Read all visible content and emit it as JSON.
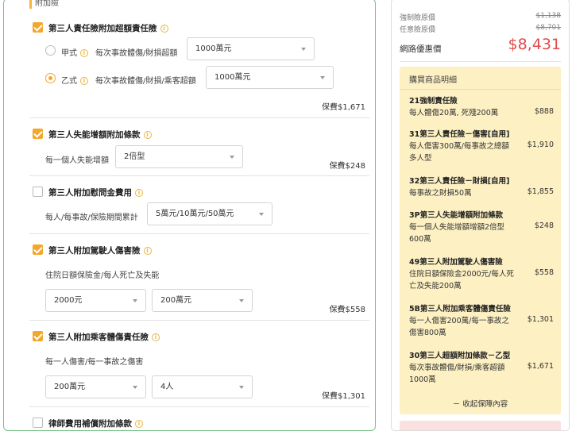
{
  "form": {
    "section_tab": "附加險",
    "sections": [
      {
        "title": "第三人責任險附加超額責任險",
        "checked": true,
        "options": [
          {
            "name": "甲式",
            "desc": "每次事故體傷/財損超額",
            "value": "1000萬元",
            "selected": false
          },
          {
            "name": "乙式",
            "desc": "每次事故體傷/財損/乘客超額",
            "value": "1000萬元",
            "selected": true
          }
        ],
        "premium": "保費$1,671"
      },
      {
        "title": "第三人失能增額附加條款",
        "checked": true,
        "label": "每一個人失能增額",
        "select": "2倍型",
        "premium": "保費$248"
      },
      {
        "title": "第三人附加慰問金費用",
        "checked": false,
        "label": "每人/每事故/保險期間累計",
        "select": "5萬元/10萬元/50萬元"
      },
      {
        "title": "第三人附加駕駛人傷害險",
        "checked": true,
        "label": "住院日額保險金/每人死亡及失能",
        "select1": "2000元",
        "select2": "200萬元",
        "premium": "保費$558"
      },
      {
        "title": "第三人附加乘客體傷責任險",
        "checked": true,
        "label": "每一人傷害/每一事故之傷害",
        "select1": "200萬元",
        "select2": "4人",
        "premium": "保費$1,301"
      },
      {
        "title": "律師費用補償附加條款",
        "checked": false
      }
    ]
  },
  "summary": {
    "compulsory_label": "強制險原價",
    "compulsory_price": "$1,138",
    "voluntary_label": "任意險原價",
    "voluntary_price": "$8,701",
    "net_label": "網路優惠價",
    "net_price": "$8,431",
    "detail_title": "購買商品明細",
    "items": [
      {
        "name": "21強制責任險",
        "desc": "每人體傷20萬, 死殘200萬",
        "price": "$888"
      },
      {
        "name": "31第三人責任險－傷害[自用]",
        "desc": "每人傷害300萬/每事故之總額多人型",
        "price": "$1,910"
      },
      {
        "name": "32第三人責任險－財損[自用]",
        "desc": "每事故之財損50萬",
        "price": "$1,855"
      },
      {
        "name": "3P第三人失能增額附加條款",
        "desc": "每一個人失能增額增額2倍型600萬",
        "price": "$248"
      },
      {
        "name": "49第三人附加駕駛人傷害險",
        "desc": "住院日額保險金2000元/每人死亡及失能200萬",
        "price": "$558"
      },
      {
        "name": "5B第三人附加乘客體傷責任險",
        "desc": "每一人傷害200萬/每一事故之傷害800萬",
        "price": "$1,301"
      },
      {
        "name": "30第三人超額附加條款－乙型",
        "desc": "每次事故體傷/財損/乘客超額1000萬",
        "price": "$1,671"
      }
    ],
    "collapse_label": "－ 收起保障內容"
  }
}
